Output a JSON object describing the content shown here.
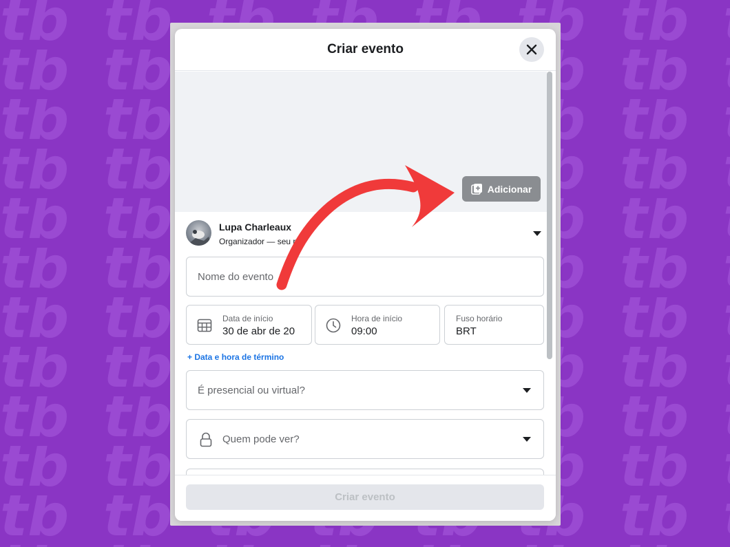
{
  "colors": {
    "background": "#8a35c4",
    "accent_blue": "#1b74e4",
    "arrow_red": "#f03a3a"
  },
  "modal": {
    "title": "Criar evento",
    "close_icon": "close-icon"
  },
  "cover": {
    "add_button_label": "Adicionar",
    "add_icon": "add-photo-icon"
  },
  "organizer": {
    "name": "Lupa Charleaux",
    "role": "Organizador — seu p"
  },
  "form": {
    "event_name_placeholder": "Nome do evento",
    "start_date_label": "Data de início",
    "start_date_value": "30 de abr de 20",
    "start_time_label": "Hora de início",
    "start_time_value": "09:00",
    "timezone_label": "Fuso horário",
    "timezone_value": "BRT",
    "end_link": "+ Data e hora de término",
    "presence_placeholder": "É presencial ou virtual?",
    "privacy_placeholder": "Quem pode ver?"
  },
  "footer": {
    "create_button": "Criar evento"
  }
}
